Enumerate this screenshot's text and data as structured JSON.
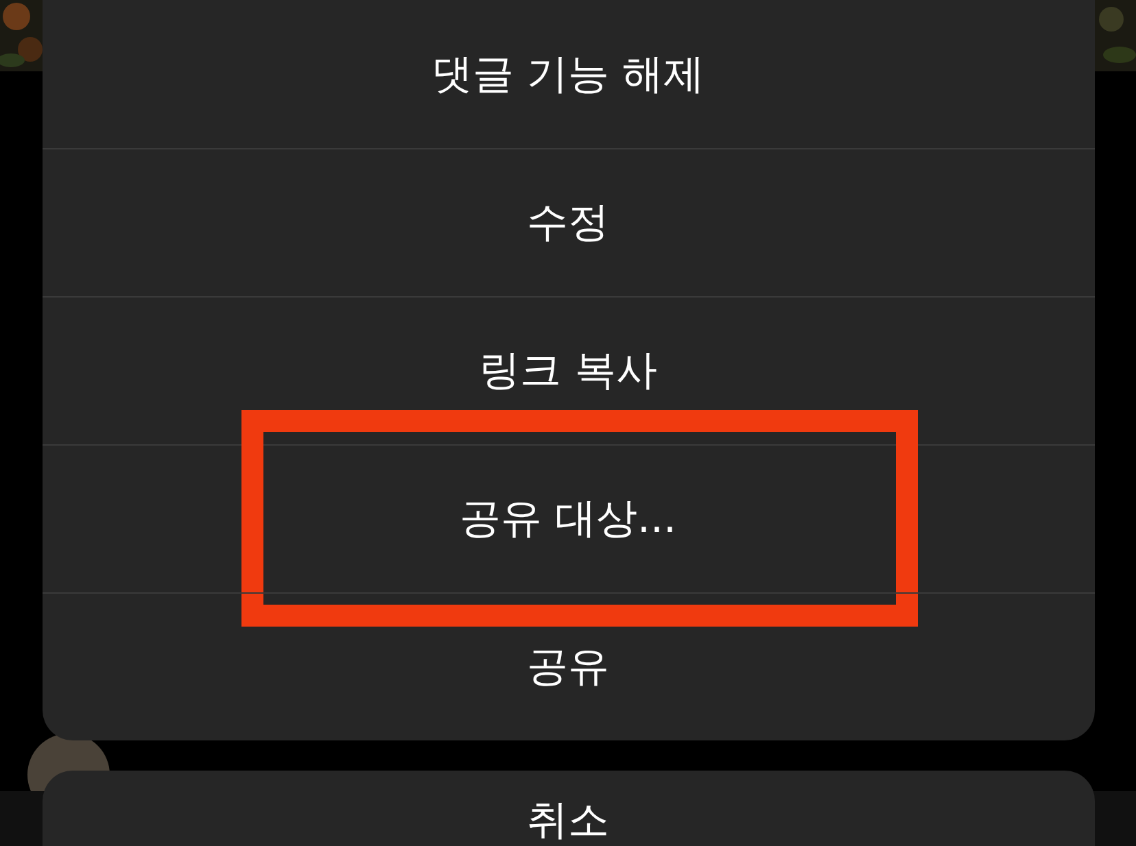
{
  "menu": {
    "items": [
      {
        "label": "댓글 기능 해제",
        "highlighted": false
      },
      {
        "label": "수정",
        "highlighted": false
      },
      {
        "label": "링크 복사",
        "highlighted": false
      },
      {
        "label": "공유 대상...",
        "highlighted": true
      },
      {
        "label": "공유",
        "highlighted": false
      }
    ]
  },
  "cancel": {
    "label": "취소"
  }
}
